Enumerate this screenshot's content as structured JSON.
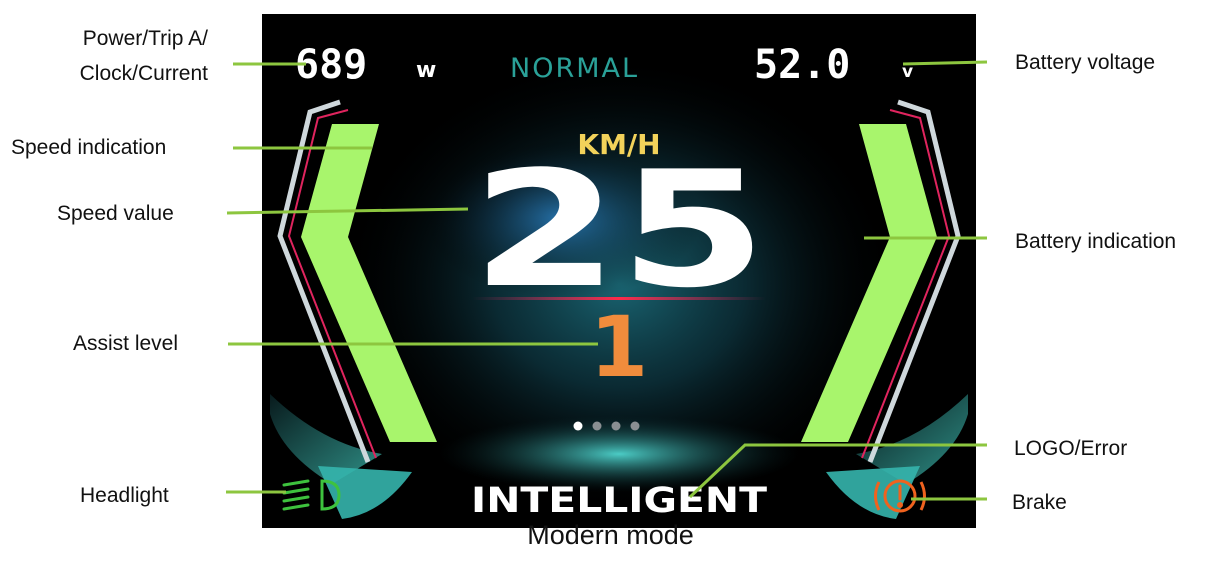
{
  "labels": {
    "power_line1": "Power/Trip A/",
    "power_line2": "Clock/Current",
    "speed_indication": "Speed indication",
    "speed_value": "Speed value",
    "assist_level": "Assist level",
    "headlight": "Headlight",
    "battery_voltage": "Battery voltage",
    "battery_indication": "Battery indication",
    "logo_error": "LOGO/Error",
    "brake": "Brake"
  },
  "display": {
    "power_value": "689",
    "power_unit": "w",
    "mode": "NORMAL",
    "voltage_value": "52.0",
    "voltage_unit": "v",
    "speed_unit": "KM/H",
    "speed": "25",
    "assist_level": "1",
    "logo": "INTELLIGENT",
    "page_dots_total": 4,
    "page_dot_active": 1,
    "speed_bar_level": 1.0,
    "battery_bar_level": 1.0
  },
  "caption": "Modern mode",
  "colors": {
    "screen_bg": "#000000",
    "bar_green": "#a8f56c",
    "leader_green": "#8dc63f",
    "mode_teal": "#2aa198",
    "unit_yellow": "#f2d25a",
    "assist_orange": "#f08c3c",
    "brake_orange": "#f0621e",
    "headlight_green": "#3ec23e",
    "accent_red": "#e0245e",
    "frame_silver": "#cfd8dc"
  },
  "icons": {
    "headlight": "headlight-icon",
    "brake": "brake-warning-icon"
  }
}
